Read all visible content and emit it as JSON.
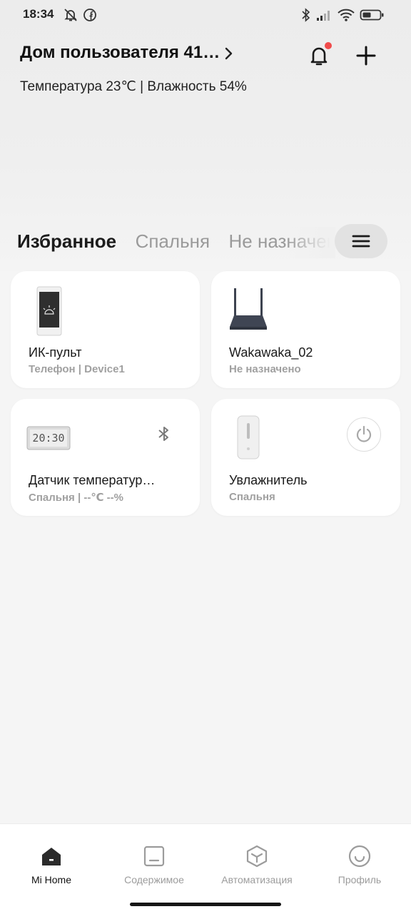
{
  "status_bar": {
    "time": "18:34",
    "left_icons": [
      "mute-notifications-icon",
      "facebook-icon"
    ],
    "right_icons": [
      "bluetooth-icon",
      "signal-icon",
      "wifi-icon",
      "battery-icon"
    ]
  },
  "header": {
    "home_name": "Дом пользователя 41…",
    "climate": "Температура 23℃ | Влажность 54%",
    "notification_badge_color": "#f04b4b"
  },
  "tabs": [
    {
      "label": "Избранное",
      "active": true
    },
    {
      "label": "Спальня",
      "active": false
    },
    {
      "label": "Не назначено",
      "active": false
    }
  ],
  "devices": [
    {
      "name": "ИК-пульт",
      "subtitle": "Телефон | Device1",
      "icon": "phone-device-icon"
    },
    {
      "name": "Wakawaka_02",
      "subtitle": "Не назначено",
      "icon": "router-device-icon"
    },
    {
      "name": "Датчик температур…",
      "subtitle": "Спальня | --℃ --%",
      "icon": "thermometer-device-icon",
      "clock_text": "20:30",
      "badge": "bluetooth-icon"
    },
    {
      "name": "Увлажнитель",
      "subtitle": "Спальня",
      "icon": "humidifier-device-icon",
      "badge": "power-icon"
    }
  ],
  "bottom_nav": [
    {
      "label": "Mi Home",
      "icon": "home-icon",
      "active": true
    },
    {
      "label": "Содержимое",
      "icon": "content-icon",
      "active": false
    },
    {
      "label": "Автоматизация",
      "icon": "automation-icon",
      "active": false
    },
    {
      "label": "Профиль",
      "icon": "profile-icon",
      "active": false
    }
  ]
}
